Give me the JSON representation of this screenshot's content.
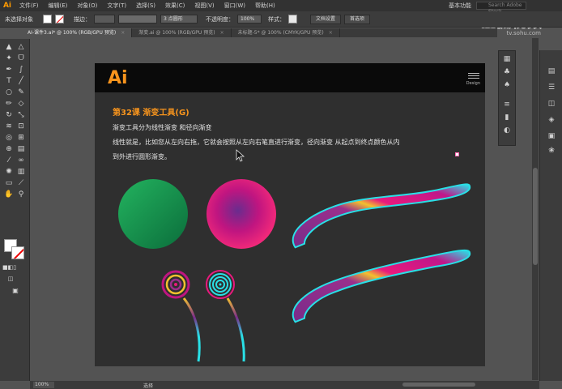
{
  "app": {
    "logo": "Ai"
  },
  "menu": [
    "文件(F)",
    "编辑(E)",
    "对象(O)",
    "文字(T)",
    "选择(S)",
    "效果(C)",
    "视图(V)",
    "窗口(W)",
    "帮助(H)"
  ],
  "workspace": {
    "label": "基本功能",
    "search_placeholder": "Search Adobe Stock"
  },
  "watermark": {
    "brand": "搜狐视频",
    "url": "tv.sohu.com"
  },
  "control": {
    "selection_label": "未选择对象",
    "stroke_label": "描边：",
    "point_value": "3 点圆形",
    "opacity_label": "不透明度：",
    "opacity_value": "100%",
    "style_label": "样式：",
    "doc_setup": "文档设置",
    "preferences": "首选项"
  },
  "tabs": [
    {
      "label": "AI-课件3.ai* @ 100% (RGB/GPU 预览)",
      "active": true
    },
    {
      "label": "渐变.ai @ 100% (RGB/GPU 预览)",
      "active": false
    },
    {
      "label": "未标题-5* @ 100% (CMYK/GPU 预览)",
      "active": false
    }
  ],
  "artboard": {
    "logo": "Ai",
    "design_label": "Design",
    "lesson_title": "第32课   渐变工具(G)",
    "lines": [
      "渐变工具分为线性渐变 和径向渐变",
      "线性就是，比如您从左向右拖，它就会按照从左向右笔直进行渐变，径向渐变 从起点到终点颜色从内",
      "到外进行圆形渐变。"
    ]
  },
  "status": {
    "zoom": "100%",
    "tool": "选择"
  },
  "colors": {
    "accent": "#f7941d",
    "artboard_bg": "#2f2f2f",
    "green_start": "#1fae5a",
    "green_end": "#0a6e3a",
    "pink": "#e8197d",
    "purple": "#7b2c8a",
    "cyan": "#29e0e6",
    "yellow": "#f2c12e"
  }
}
